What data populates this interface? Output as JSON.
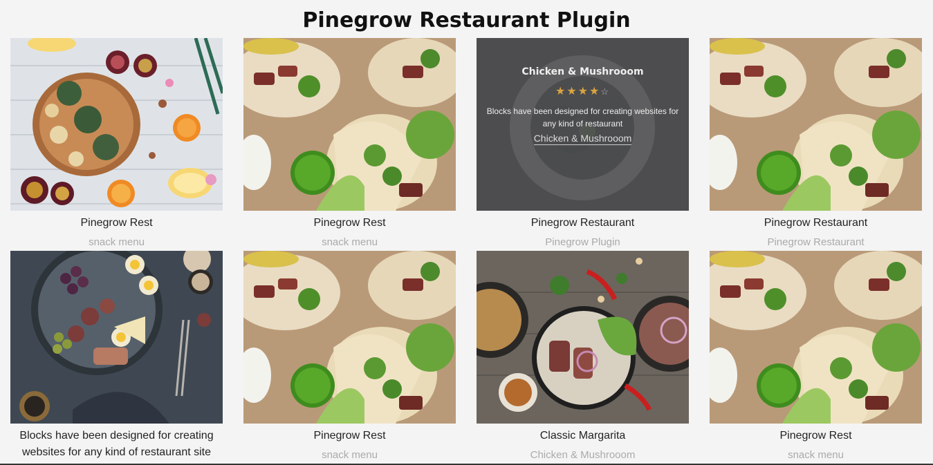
{
  "page": {
    "title": "Pinegrow Restaurant Plugin"
  },
  "cards": [
    {
      "caption": "Pinegrow Rest",
      "subcaption": "snack menu",
      "image": "fruit-board-photo"
    },
    {
      "caption": "Pinegrow Rest",
      "subcaption": "snack menu",
      "image": "tacos-photo"
    },
    {
      "caption": "Pinegrow Restaurant",
      "subcaption": "Pinegrow Plugin",
      "image": "mussels-photo",
      "overlay": {
        "title": "Chicken & Mushrooom",
        "stars_filled": "★★★★",
        "stars_empty": "☆",
        "rating": 4,
        "description": "Blocks have been designed for creating websites for any kind of restaurant",
        "link": "Chicken & Mushrooom"
      }
    },
    {
      "caption": "Pinegrow Restaurant",
      "subcaption": "Pinegrow Restaurant",
      "image": "tacos-photo"
    },
    {
      "caption": "Blocks have been designed for creating websites for any kind of restaurant site",
      "subcaption": "",
      "image": "cheese-platter-photo"
    },
    {
      "caption": "Pinegrow Rest",
      "subcaption": "snack menu",
      "image": "tacos-photo"
    },
    {
      "caption": "Classic Margarita",
      "subcaption": "Chicken & Mushrooom",
      "image": "steak-salad-photo"
    },
    {
      "caption": "Pinegrow Rest",
      "subcaption": "snack menu",
      "image": "tacos-photo"
    }
  ],
  "colors": {
    "background": "#f4f4f4",
    "caption": "#222222",
    "subcaption": "#aaaaaa",
    "star": "#d9a441"
  }
}
